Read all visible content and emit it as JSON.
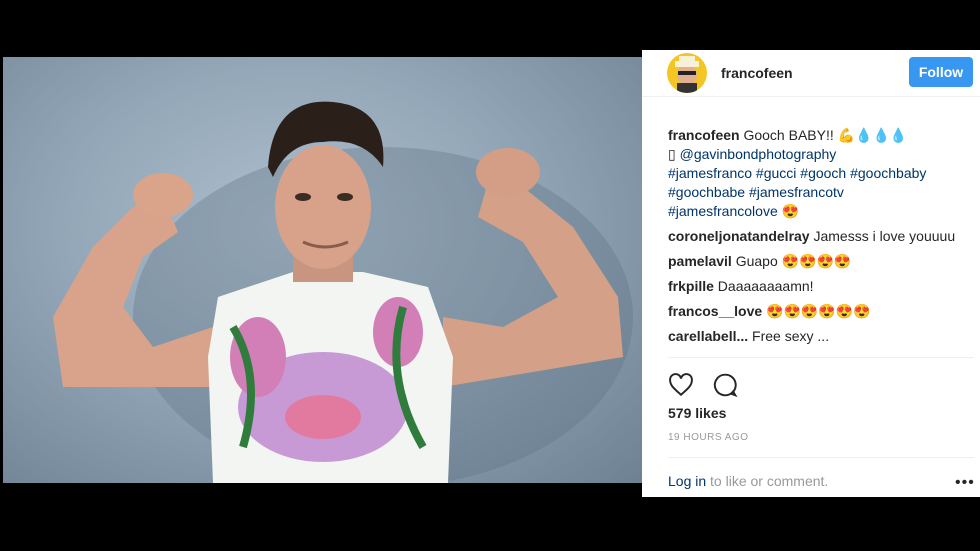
{
  "post": {
    "username": "francofeen",
    "follow_label": "Follow",
    "caption": {
      "username": "francofeen",
      "text1": " Gooch BABY!! 💪💧💧💧",
      "box_glyph": "▯",
      "photographer": "@gavinbondphotography",
      "hashtags_line1": "#jamesfranco #gucci #gooch #goochbaby",
      "hashtags_line2": "#goochbabe #jamesfrancotv",
      "hashtags_line3": "#jamesfrancolove",
      "emoji_end": " 😍"
    },
    "comments": [
      {
        "user": "coroneljonatandelray",
        "text": " Jamesss i love youuuu"
      },
      {
        "user": "pamelavil",
        "text": " Guapo 😍😍😍😍"
      },
      {
        "user": "frkpille",
        "text": " Daaaaaaaamn!"
      },
      {
        "user": "francos__love",
        "text": " 😍😍😍😍😍😍"
      },
      {
        "user": "carellabell...",
        "text": " Free sexy ..."
      }
    ],
    "likes": "579 likes",
    "timestamp": "19 HOURS AGO",
    "login_label": "Log in",
    "comment_prompt": " to like or comment.",
    "more_label": "•••",
    "icons": {
      "like": "heart-icon",
      "comment": "comment-icon",
      "more": "more-options-icon"
    },
    "colors": {
      "follow": "#3897f0",
      "link": "#003569",
      "muted": "#999999"
    }
  }
}
